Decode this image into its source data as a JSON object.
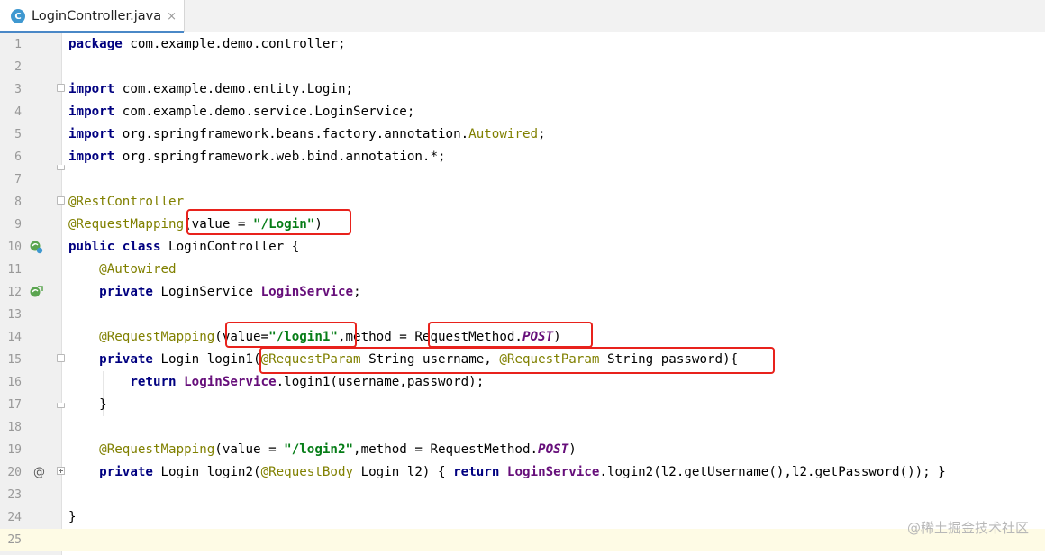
{
  "tab": {
    "icon_letter": "C",
    "title": "LoginController.java",
    "close": "×"
  },
  "lines": [
    {
      "n": "1",
      "t": "package com.example.demo.controller;"
    },
    {
      "n": "2",
      "t": ""
    },
    {
      "n": "3",
      "t": "import com.example.demo.entity.Login;"
    },
    {
      "n": "4",
      "t": "import com.example.demo.service.LoginService;"
    },
    {
      "n": "5",
      "t": "import org.springframework.beans.factory.annotation.Autowired;"
    },
    {
      "n": "6",
      "t": "import org.springframework.web.bind.annotation.*;"
    },
    {
      "n": "7",
      "t": ""
    },
    {
      "n": "8",
      "t": "@RestController"
    },
    {
      "n": "9",
      "t": "@RequestMapping(value = \"/Login\")"
    },
    {
      "n": "10",
      "t": "public class LoginController {"
    },
    {
      "n": "11",
      "t": "    @Autowired"
    },
    {
      "n": "12",
      "t": "    private LoginService LoginService;"
    },
    {
      "n": "13",
      "t": ""
    },
    {
      "n": "14",
      "t": "    @RequestMapping(value=\"/login1\",method = RequestMethod.POST)"
    },
    {
      "n": "15",
      "t": "    private Login login1(@RequestParam String username, @RequestParam String password){"
    },
    {
      "n": "16",
      "t": "        return LoginService.login1(username,password);"
    },
    {
      "n": "17",
      "t": "    }"
    },
    {
      "n": "18",
      "t": ""
    },
    {
      "n": "19",
      "t": "    @RequestMapping(value = \"/login2\",method = RequestMethod.POST)"
    },
    {
      "n": "20",
      "t": "    private Login login2(@RequestBody Login l2) { return LoginService.login2(l2.getUsername(),l2.getPassword()); }"
    },
    {
      "n": "23",
      "t": ""
    },
    {
      "n": "24",
      "t": "}"
    },
    {
      "n": "25",
      "t": ""
    }
  ],
  "watermark": "@稀土掘金技术社区",
  "colors": {
    "highlight_box": "#e8221c",
    "keyword": "#000080",
    "annotation": "#808000",
    "string": "#067d17",
    "field": "#660e7a"
  }
}
